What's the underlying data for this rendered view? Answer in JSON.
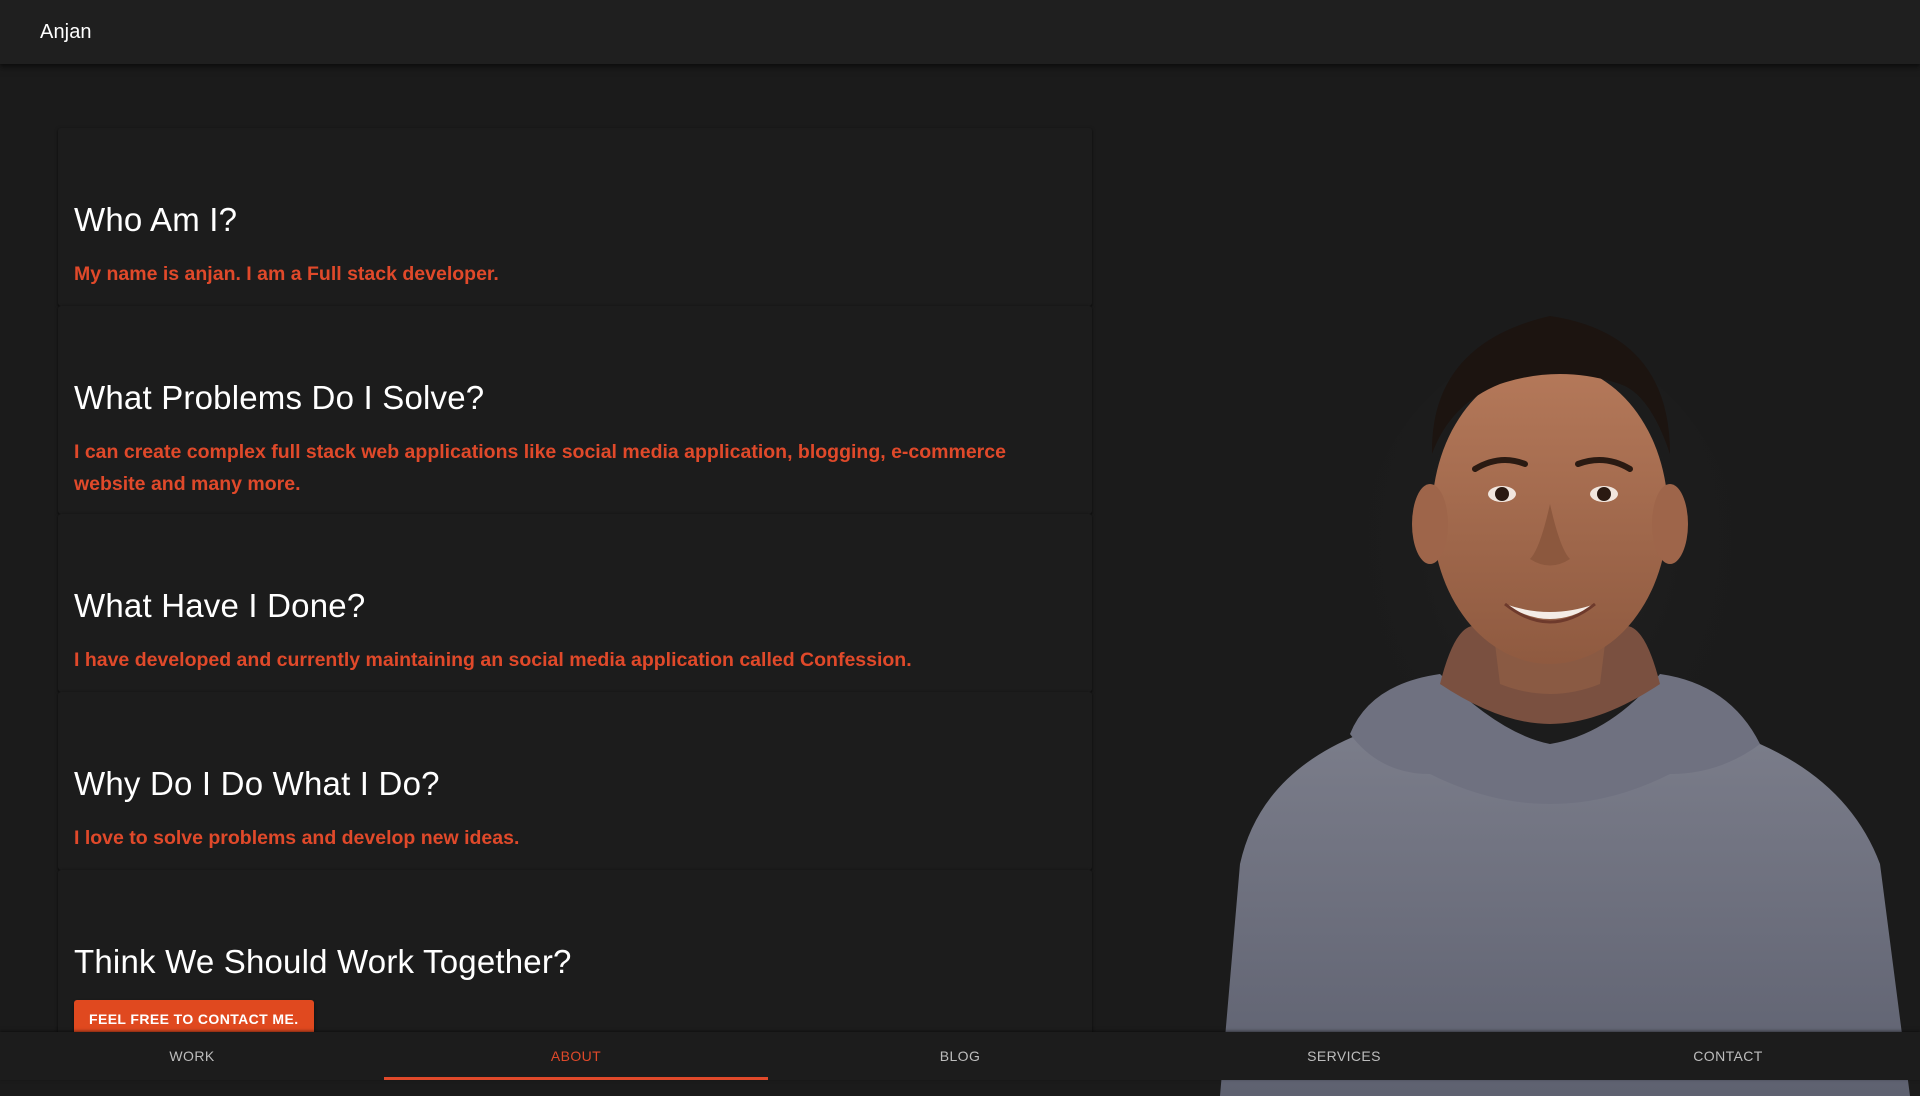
{
  "header": {
    "title": "Anjan"
  },
  "about": {
    "cards": [
      {
        "heading": "Who Am I?",
        "text": "My name is anjan. I am a Full stack developer."
      },
      {
        "heading": "What Problems Do I Solve?",
        "text": "I can create complex full stack web applications like social media application, blogging, e-commerce website and many more."
      },
      {
        "heading": "What Have I Done?",
        "text": "I have developed and currently maintaining an social media application called Confession."
      },
      {
        "heading": "Why Do I Do What I Do?",
        "text": "I love to solve problems and develop new ideas."
      },
      {
        "heading": "Think We Should Work Together?",
        "button": "Feel free to contact me."
      }
    ]
  },
  "nav": {
    "items": [
      "WORK",
      "ABOUT",
      "BLOG",
      "SERVICES",
      "CONTACT"
    ],
    "active": "ABOUT"
  },
  "colors": {
    "background": "#1b1b1b",
    "accent": "#e0492a",
    "heading": "#ffffff",
    "nav_inactive": "#bdbdbd"
  },
  "images": {
    "portrait": "profile-photo"
  }
}
